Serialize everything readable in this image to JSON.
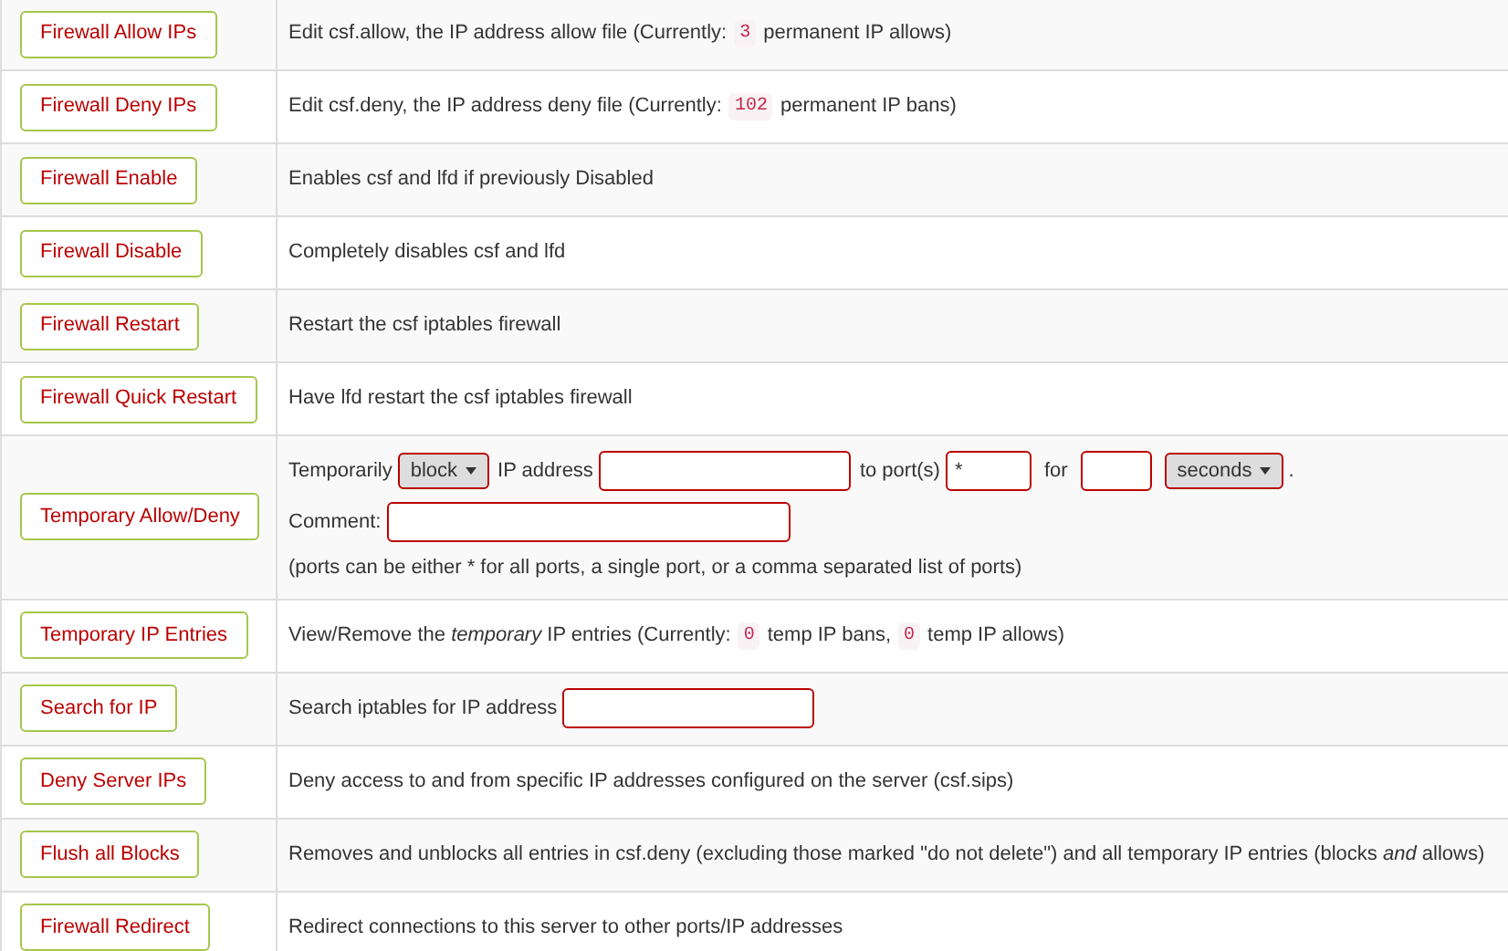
{
  "rows": [
    {
      "kind": "text",
      "button": "Firewall Allow IPs",
      "parts": [
        {
          "text": "Edit csf.allow, the IP address allow file (Currently:"
        },
        {
          "code": "3"
        },
        {
          "text": "permanent IP allows)"
        }
      ]
    },
    {
      "kind": "text",
      "button": "Firewall Deny IPs",
      "parts": [
        {
          "text": "Edit csf.deny, the IP address deny file (Currently:"
        },
        {
          "code": "102"
        },
        {
          "text": "permanent IP bans)"
        }
      ]
    },
    {
      "kind": "text",
      "button": "Firewall Enable",
      "parts": [
        {
          "text": "Enables csf and lfd if previously Disabled"
        }
      ]
    },
    {
      "kind": "text",
      "button": "Firewall Disable",
      "parts": [
        {
          "text": "Completely disables csf and lfd"
        }
      ]
    },
    {
      "kind": "text",
      "button": "Firewall Restart",
      "parts": [
        {
          "text": "Restart the csf iptables firewall"
        }
      ]
    },
    {
      "kind": "text",
      "button": "Firewall Quick Restart",
      "parts": [
        {
          "text": "Have lfd restart the csf iptables firewall"
        }
      ]
    },
    {
      "kind": "temp",
      "button": "Temporary Allow/Deny",
      "prefix": "Temporarily",
      "action_select": "block",
      "ip_label": "IP address",
      "port_label": "to port(s)",
      "port_value": "*",
      "for_label": "for",
      "unit_select": "seconds",
      "period": ".",
      "comment_label": "Comment:",
      "note": "(ports can be either * for all ports, a single port, or a comma separated list of ports)"
    },
    {
      "kind": "text",
      "button": "Temporary IP Entries",
      "parts": [
        {
          "text": "View/Remove the *temporary* IP entries (Currently:"
        },
        {
          "code": "0"
        },
        {
          "text": "temp IP bans,"
        },
        {
          "code": "0"
        },
        {
          "text": "temp IP allows)"
        }
      ]
    },
    {
      "kind": "search",
      "button": "Search for IP",
      "label": "Search iptables for IP address"
    },
    {
      "kind": "text",
      "button": "Deny Server IPs",
      "parts": [
        {
          "text": "Deny access to and from specific IP addresses configured on the server (csf.sips)"
        }
      ]
    },
    {
      "kind": "text",
      "button": "Flush all Blocks",
      "parts": [
        {
          "text": "Removes and unblocks all entries in csf.deny (excluding those marked \"do not delete\") and all temporary IP entries (blocks *and* allows)"
        }
      ]
    },
    {
      "kind": "text",
      "button": "Firewall Redirect",
      "parts": [
        {
          "text": "Redirect connections to this server to other ports/IP addresses"
        }
      ]
    }
  ]
}
